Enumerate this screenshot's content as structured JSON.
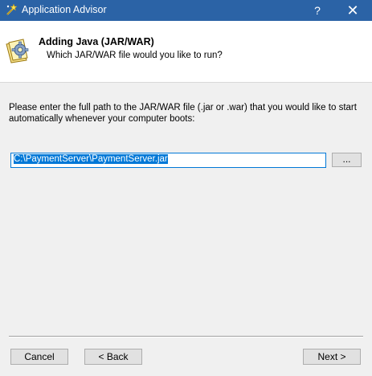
{
  "window": {
    "title": "Application Advisor",
    "help_glyph": "?",
    "close_glyph": "✕",
    "app_icon": "magic-wand-icon"
  },
  "header": {
    "icon": "gear-document-icon",
    "title": "Adding Java (JAR/WAR)",
    "subtitle": "Which JAR/WAR file would you like to run?"
  },
  "body": {
    "instructions": "Please enter the full path to the JAR/WAR file (.jar or .war) that you would like to start automatically whenever your computer boots:",
    "path_value": "C:\\PaymentServer\\PaymentServer.jar",
    "browse_label": "..."
  },
  "footer": {
    "cancel_label": "Cancel",
    "back_label": "< Back",
    "next_label": "Next >"
  },
  "colors": {
    "titlebar": "#2b63a6",
    "selection": "#0078d7",
    "dialog_bg": "#f0f0f0"
  }
}
